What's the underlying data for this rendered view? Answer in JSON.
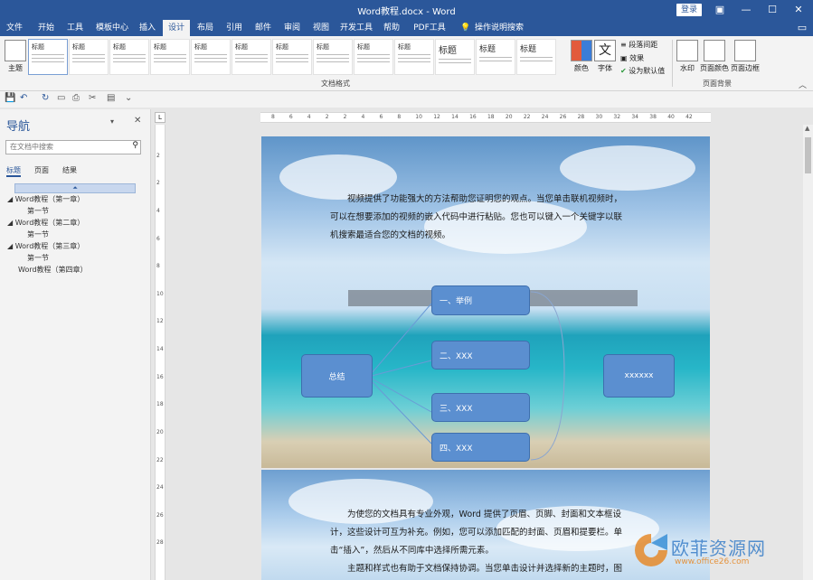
{
  "titlebar": {
    "title": "Word教程.docx - Word",
    "login": "登录"
  },
  "window_controls": [
    "▣",
    "—",
    "☐",
    "✕",
    "▭"
  ],
  "tabs": [
    "文件",
    "开始",
    "工具",
    "模板中心",
    "插入",
    "设计",
    "布局",
    "引用",
    "邮件",
    "审阅",
    "视图",
    "开发工具",
    "帮助",
    "PDF工具集",
    "操作说明搜索"
  ],
  "active_tab": "设计",
  "ribbon": {
    "theme_label": "主题",
    "gallery_headings": [
      "标题",
      "标题",
      "标题",
      "标题",
      "标题",
      "标题",
      "标题",
      "标题",
      "标题",
      "标题",
      "标题",
      "标题",
      "标题",
      "标题"
    ],
    "colors_label": "颜色",
    "fonts_label": "字体",
    "paragraph_spacing": "段落间距",
    "effects": "效果",
    "set_default": "设为默认值",
    "watermark": "水印",
    "page_color": "页面颜色",
    "page_border": "页面边框",
    "group_doc_format": "文档格式",
    "group_page_background": "页面背景"
  },
  "nav": {
    "title": "导航",
    "search_placeholder": "在文档中搜索",
    "tabs": [
      "标题",
      "页面",
      "结果"
    ],
    "items": [
      {
        "label": "Word教程（第一章）",
        "level": 1
      },
      {
        "label": "第一节",
        "level": 2
      },
      {
        "label": "Word教程（第二章）",
        "level": 1
      },
      {
        "label": "第一节",
        "level": 2
      },
      {
        "label": "Word教程（第三章）",
        "level": 1
      },
      {
        "label": "第一节",
        "level": 2
      },
      {
        "label": "Word教程（第四章）",
        "level": 1
      }
    ]
  },
  "ruler_h_ticks": [
    "8",
    "6",
    "4",
    "2",
    "2",
    "4",
    "6",
    "8",
    "10",
    "12",
    "14",
    "16",
    "18",
    "20",
    "22",
    "24",
    "26",
    "28",
    "30",
    "32",
    "34",
    "38",
    "40",
    "42"
  ],
  "ruler_v_ticks": [
    "2",
    "2",
    "4",
    "6",
    "8",
    "10",
    "12",
    "14",
    "16",
    "18",
    "20",
    "22",
    "24",
    "26",
    "28"
  ],
  "page1": {
    "paragraph": [
      "视频提供了功能强大的方法帮助您证明您的观点。当您单击联机视频时，",
      "可以在想要添加的视频的嵌入代码中进行粘贴。您也可以键入一个关键字以联",
      "机搜索最适合您的文档的视频。"
    ],
    "diagram": {
      "summary": "总结",
      "items": [
        "一、举例",
        "二、XXX",
        "三、XXX",
        "四、XXX"
      ],
      "right": "xxxxxx"
    }
  },
  "page2": {
    "paragraph": [
      "为使您的文档具有专业外观，Word 提供了页眉、页脚、封面和文本框设",
      "计，这些设计可互为补充。例如，您可以添加匹配的封面、页眉和提要栏。单",
      "击“插入”，然后从不同库中选择所需元素。",
      "主题和样式也有助于文档保持协调。当您单击设计并选择新的主题时，图"
    ]
  },
  "watermark": {
    "text": "欧菲资源网",
    "url": "www.office26.com"
  }
}
